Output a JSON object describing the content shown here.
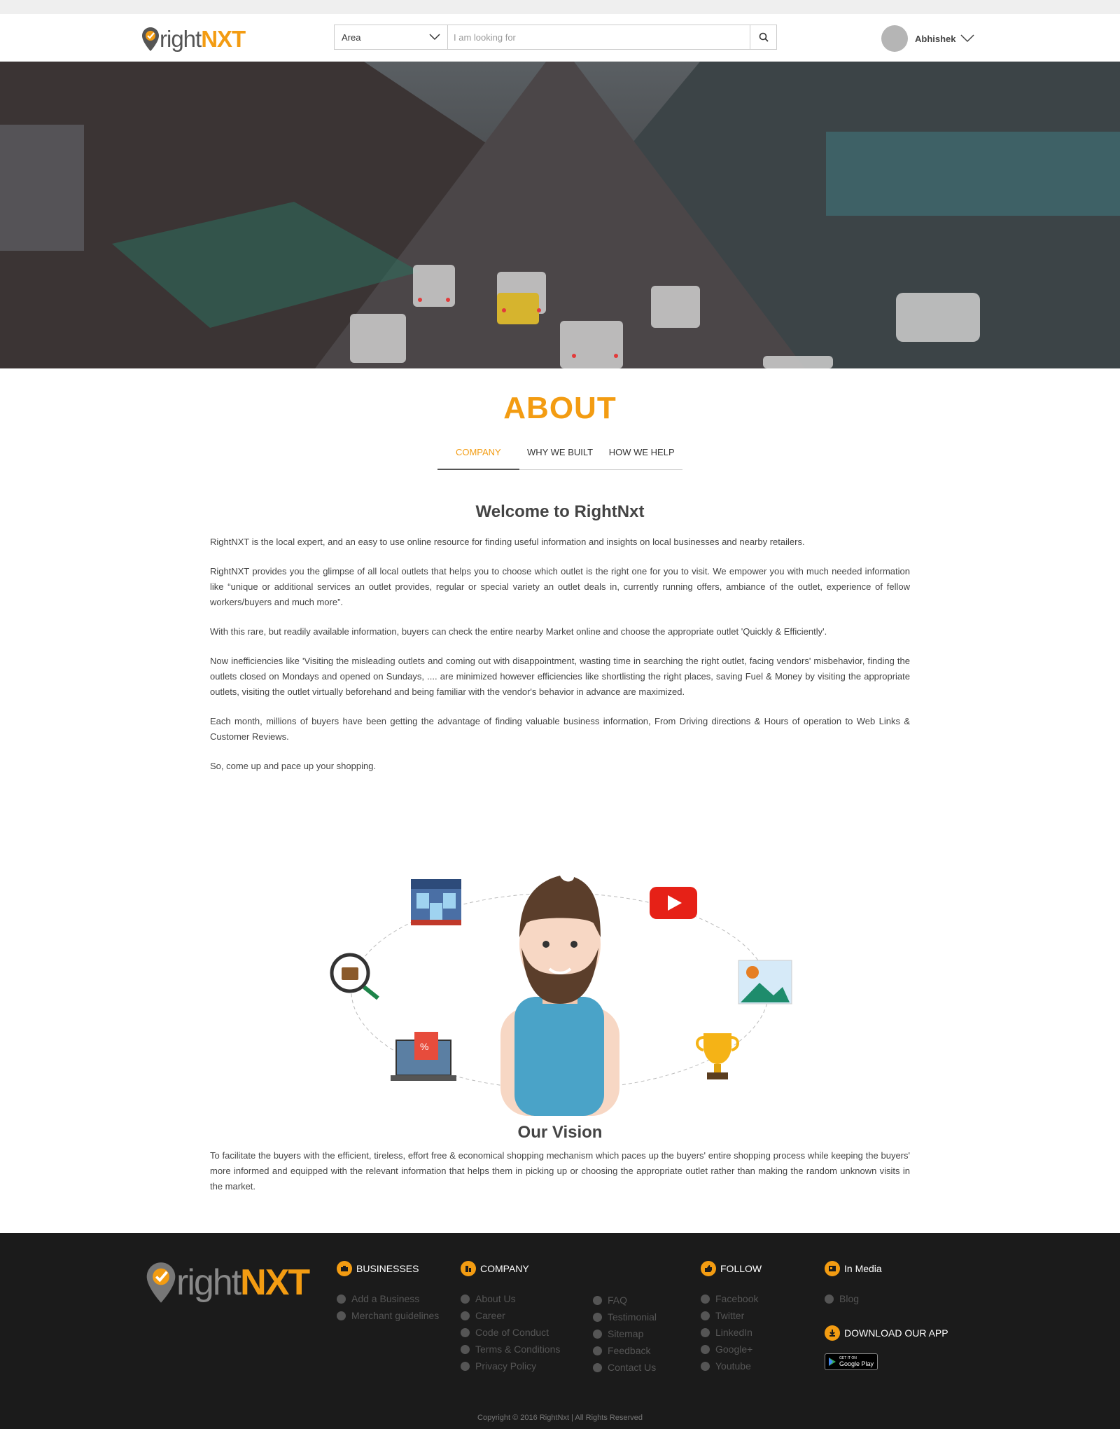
{
  "header": {
    "logo_right": "right",
    "logo_nxt": "NXT",
    "area_label": "Area",
    "search_placeholder": "I am looking for",
    "username": "Abhishek"
  },
  "page": {
    "title": "ABOUT",
    "tabs": [
      "COMPANY",
      "WHY WE BUILT",
      "HOW WE HELP"
    ],
    "active_tab": "COMPANY"
  },
  "company": {
    "heading": "Welcome to RightNxt",
    "paragraphs": [
      "RightNXT is the local expert, and an easy to use online resource for finding useful information and insights on local businesses and nearby retailers.",
      "RightNXT provides you the glimpse of all local outlets that helps you to choose which outlet is the right one for you to visit. We empower you with much needed information like “unique or additional services an outlet provides, regular or special variety an outlet deals in, currently running offers, ambiance of the outlet, experience of fellow workers/buyers and much more”.",
      "With this rare, but readily available information, buyers can check the entire nearby Market online and choose the appropriate outlet 'Quickly & Efficiently'.",
      "Now inefficiencies like 'Visiting the misleading outlets and coming out with disappointment, wasting time in searching the right outlet, facing vendors' misbehavior, finding the outlets closed on Mondays and opened on Sundays, .... are minimized however efficiencies like shortlisting the right places, saving Fuel & Money by visiting the appropriate outlets, visiting the outlet virtually beforehand and being familiar with the vendor's behavior in advance are maximized.",
      "Each month, millions of buyers have been getting the advantage of finding valuable business information, From Driving directions & Hours of operation to Web Links & Customer Reviews.",
      "So, come up and pace up your shopping."
    ]
  },
  "vision": {
    "heading": "Our Vision",
    "text": "To facilitate the buyers with the efficient, tireless, effort free & economical shopping mechanism which paces up the buyers' entire shopping process while keeping the buyers' more informed and equipped with the relevant information that helps them in picking up or choosing the appropriate outlet rather than making the random unknown visits in the market."
  },
  "footer": {
    "logo_right": "right",
    "logo_nxt": "NXT",
    "businesses": {
      "title": "BUSINESSES",
      "items": [
        "Add a Business",
        "Merchant guidelines"
      ]
    },
    "company": {
      "title": "COMPANY",
      "items": [
        "About Us",
        "Career",
        "Code of Conduct",
        "Terms & Conditions",
        "Privacy Policy"
      ]
    },
    "more": {
      "items": [
        "FAQ",
        "Testimonial",
        "Sitemap",
        "Feedback",
        "Contact Us"
      ]
    },
    "follow": {
      "title": "FOLLOW",
      "items": [
        "Facebook",
        "Twitter",
        "LinkedIn",
        "Google+",
        "Youtube"
      ]
    },
    "media": {
      "title": "In Media",
      "items": [
        "Blog"
      ]
    },
    "download": {
      "title": "DOWNLOAD OUR APP",
      "badge_small": "GET IT ON",
      "badge_big": "Google Play"
    },
    "copyright": "Copyright © 2016 RightNxt | All Rights Reserved"
  },
  "colors": {
    "accent": "#f39c12",
    "footer_bg": "#1b1b1b",
    "youtube": "#e62117"
  }
}
